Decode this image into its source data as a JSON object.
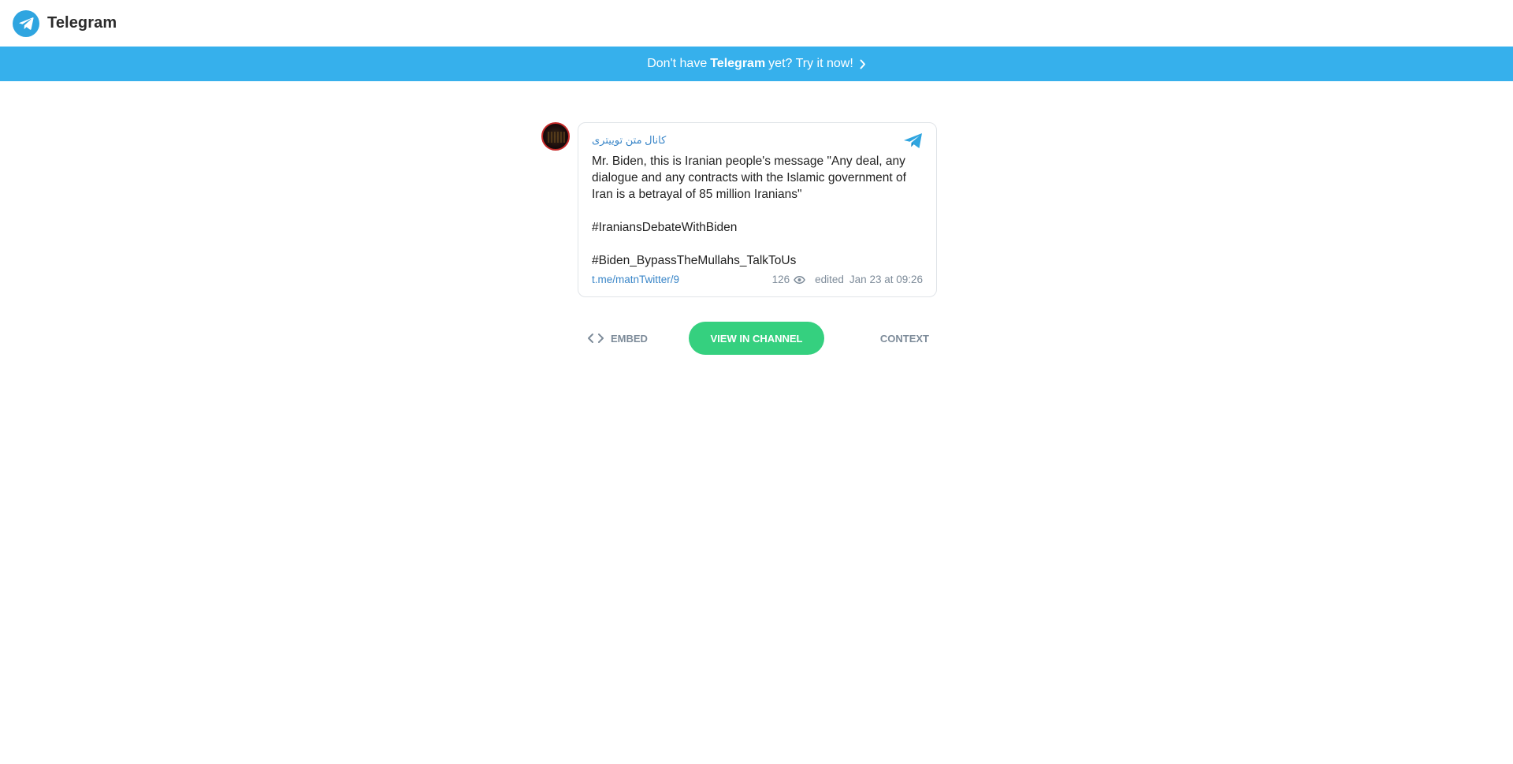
{
  "header": {
    "brand_name": "Telegram"
  },
  "banner": {
    "prefix": "Don't have",
    "brand": "Telegram",
    "suffix": "yet? Try it now!"
  },
  "post": {
    "channel_name": "کانال متن توییتری",
    "text": "Mr. Biden, this is Iranian people's message \"Any deal, any dialogue and any contracts with the Islamic government of Iran is a betrayal of 85 million Iranians\"\n\n#IraniansDebateWithBiden\n\n#Biden_BypassTheMullahs_TalkToUs",
    "link": "t.me/matnTwitter/9",
    "views": "126",
    "edited_label": "edited",
    "date": "Jan 23 at 09:26"
  },
  "actions": {
    "embed_label": "EMBED",
    "view_label": "VIEW IN CHANNEL",
    "context_label": "CONTEXT"
  },
  "colors": {
    "accent": "#36b0ec",
    "link": "#3a86c8",
    "green": "#35d07f",
    "muted": "#7d8b99"
  },
  "icons": {
    "logo": "telegram-logo-icon",
    "banner_chevron": "chevron-right-icon",
    "share": "telegram-share-icon",
    "views": "eye-icon",
    "embed": "code-icon"
  }
}
